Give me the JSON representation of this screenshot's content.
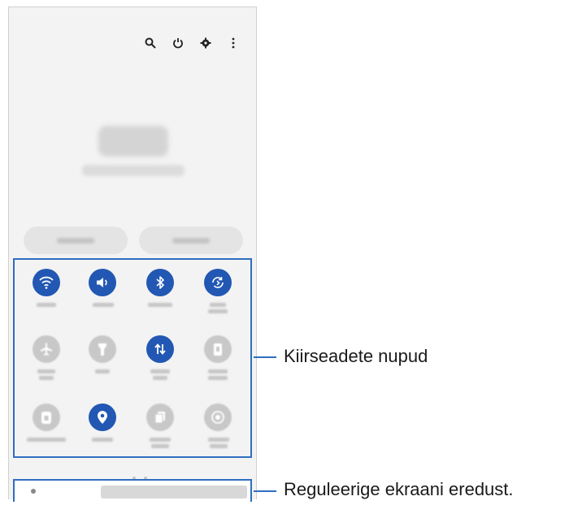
{
  "annotations": {
    "quick_settings_label": "Kiirseadete nupud",
    "brightness_label": "Reguleerige ekraani eredust."
  },
  "colors": {
    "accent": "#2258b3",
    "callout_line": "#2f6ec0",
    "inactive": "#c8c8c8"
  },
  "quick_settings": {
    "buttons": [
      {
        "icon": "wifi-icon",
        "state": "on"
      },
      {
        "icon": "sound-icon",
        "state": "on"
      },
      {
        "icon": "bluetooth-icon",
        "state": "on"
      },
      {
        "icon": "auto-rotate-icon",
        "state": "on"
      },
      {
        "icon": "airplane-icon",
        "state": "off"
      },
      {
        "icon": "flashlight-icon",
        "state": "off"
      },
      {
        "icon": "mobile-data-icon",
        "state": "on"
      },
      {
        "icon": "battery-saver-icon",
        "state": "off"
      },
      {
        "icon": "power-sharing-icon",
        "state": "off"
      },
      {
        "icon": "location-icon",
        "state": "on"
      },
      {
        "icon": "link-to-windows-icon",
        "state": "off"
      },
      {
        "icon": "screen-recorder-icon",
        "state": "off"
      }
    ]
  }
}
